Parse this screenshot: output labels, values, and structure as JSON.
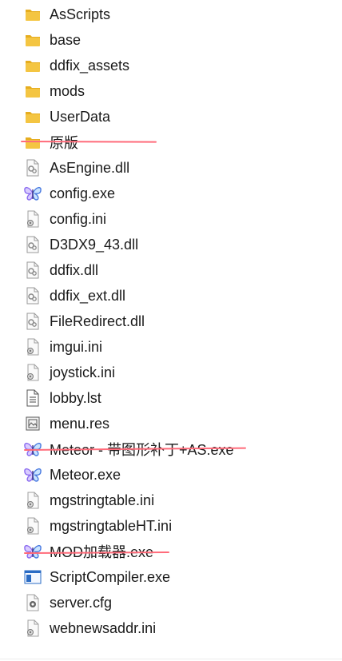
{
  "files": [
    {
      "name": "AsScripts",
      "icon": "folder-icon"
    },
    {
      "name": "base",
      "icon": "folder-icon"
    },
    {
      "name": "ddfix_assets",
      "icon": "folder-icon"
    },
    {
      "name": "mods",
      "icon": "folder-icon"
    },
    {
      "name": "UserData",
      "icon": "folder-icon"
    },
    {
      "name": "原版",
      "icon": "folder-icon"
    },
    {
      "name": "AsEngine.dll",
      "icon": "dll-icon"
    },
    {
      "name": "config.exe",
      "icon": "butterfly-app-icon"
    },
    {
      "name": "config.ini",
      "icon": "ini-settings-icon"
    },
    {
      "name": "D3DX9_43.dll",
      "icon": "dll-icon"
    },
    {
      "name": "ddfix.dll",
      "icon": "dll-icon"
    },
    {
      "name": "ddfix_ext.dll",
      "icon": "dll-icon"
    },
    {
      "name": "FileRedirect.dll",
      "icon": "dll-icon"
    },
    {
      "name": "imgui.ini",
      "icon": "ini-settings-icon"
    },
    {
      "name": "joystick.ini",
      "icon": "ini-settings-icon"
    },
    {
      "name": "lobby.lst",
      "icon": "text-file-icon"
    },
    {
      "name": "menu.res",
      "icon": "resource-file-icon"
    },
    {
      "name": "Meteor - 带图形补丁+AS.exe",
      "icon": "butterfly-app-icon"
    },
    {
      "name": "Meteor.exe",
      "icon": "butterfly-app-icon"
    },
    {
      "name": "mgstringtable.ini",
      "icon": "ini-settings-icon"
    },
    {
      "name": "mgstringtableHT.ini",
      "icon": "ini-settings-icon"
    },
    {
      "name": "MOD加载器.exe",
      "icon": "butterfly-app-icon"
    },
    {
      "name": "ScriptCompiler.exe",
      "icon": "window-app-icon"
    },
    {
      "name": "server.cfg",
      "icon": "gear-file-icon"
    },
    {
      "name": "webnewsaddr.ini",
      "icon": "ini-settings-icon"
    }
  ],
  "colors": {
    "folder": "#f4c542",
    "folder_dark": "#e6ad1f",
    "strike": "#ff6b7a",
    "butterfly": "#8b6cf0",
    "app_blue": "#2b6cc4"
  }
}
